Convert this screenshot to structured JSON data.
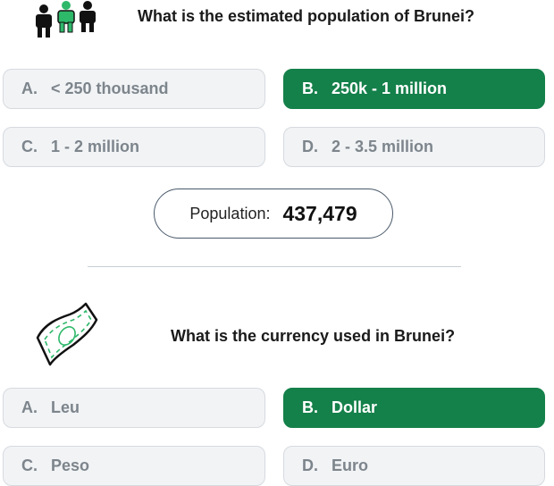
{
  "colors": {
    "correct_bg": "#14804a",
    "option_bg": "#f1f3f5",
    "option_text": "#7d858c"
  },
  "q1": {
    "icon": "people-icon",
    "question": "What is the estimated population of Brunei?",
    "options": [
      {
        "letter": "A.",
        "text": "< 250 thousand",
        "correct": false
      },
      {
        "letter": "B.",
        "text": "250k - 1 million",
        "correct": true
      },
      {
        "letter": "C.",
        "text": "1 - 2 million",
        "correct": false
      },
      {
        "letter": "D.",
        "text": "2 - 3.5 million",
        "correct": false
      }
    ],
    "result_label": "Population:",
    "result_value": "437,479"
  },
  "q2": {
    "icon": "banknote-icon",
    "question": "What is the currency used in Brunei?",
    "options": [
      {
        "letter": "A.",
        "text": "Leu",
        "correct": false
      },
      {
        "letter": "B.",
        "text": "Dollar",
        "correct": true
      },
      {
        "letter": "C.",
        "text": "Peso",
        "correct": false
      },
      {
        "letter": "D.",
        "text": "Euro",
        "correct": false
      }
    ]
  }
}
